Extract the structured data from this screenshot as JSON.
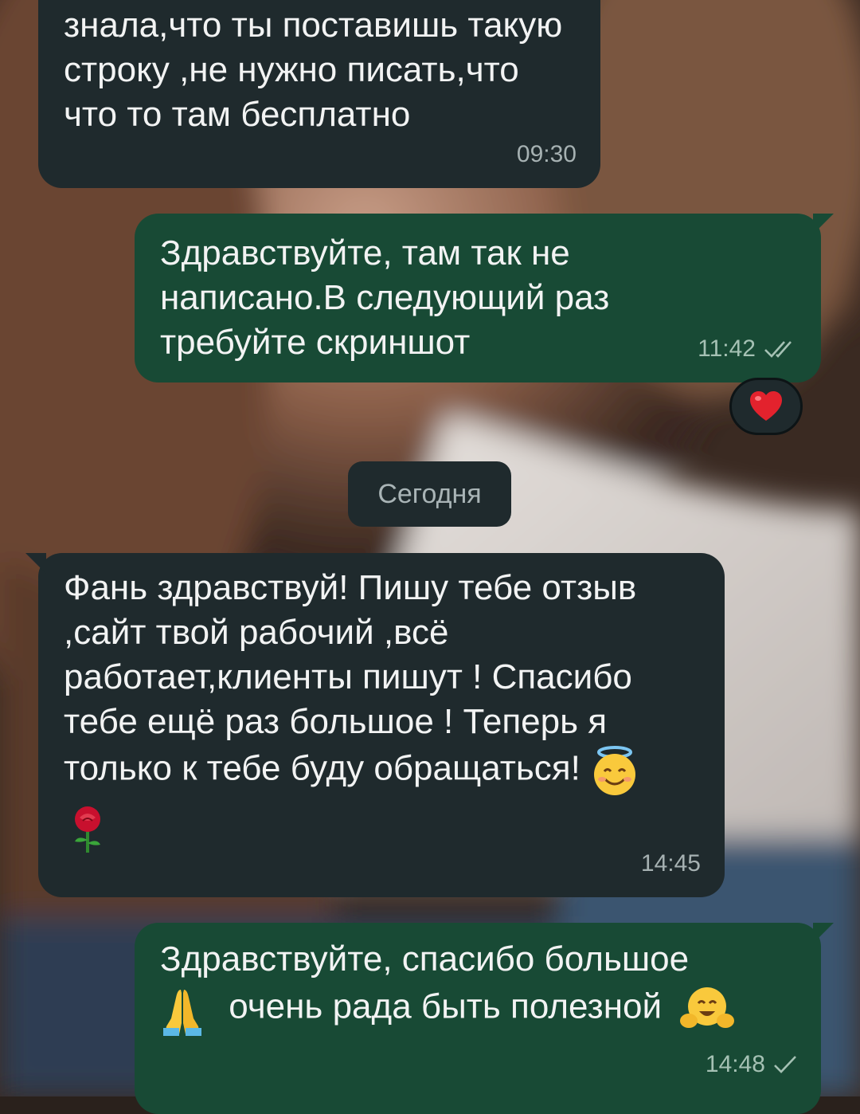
{
  "messages": [
    {
      "direction": "incoming",
      "text": "знала,что ты поставишь такую строку ,не нужно писать,что что то там бесплатно",
      "time": "09:30"
    },
    {
      "direction": "outgoing",
      "text": "Здравствуйте, там так не написано.В следующий раз требуйте скриншот",
      "time": "11:42",
      "status_icon": "double-check-icon",
      "reaction": "red-heart-emoji"
    },
    {
      "direction": "incoming",
      "text": "Фань здравствуй! Пишу тебе отзыв ,сайт твой рабочий ,всё работает,клиенты пишут ! Спасибо тебе ещё раз большое ! Теперь я только к тебе буду обращаться!",
      "emojis": [
        "smiling-face-with-halo-emoji",
        "rose-emoji"
      ],
      "time": "14:45"
    },
    {
      "direction": "outgoing",
      "text_line1": "Здравствуйте, спасибо большое",
      "text_line2": "очень рада быть полезной",
      "emojis": [
        "folded-hands-emoji",
        "hugging-face-emoji"
      ],
      "time": "14:48",
      "status_icon": "single-check-icon"
    }
  ],
  "date_separator": "Сегодня",
  "colors": {
    "incoming_bubble": "#1f2a2d",
    "outgoing_bubble": "#184a35",
    "text": "#f2f3f3",
    "meta_text": "#a6b1b2"
  }
}
